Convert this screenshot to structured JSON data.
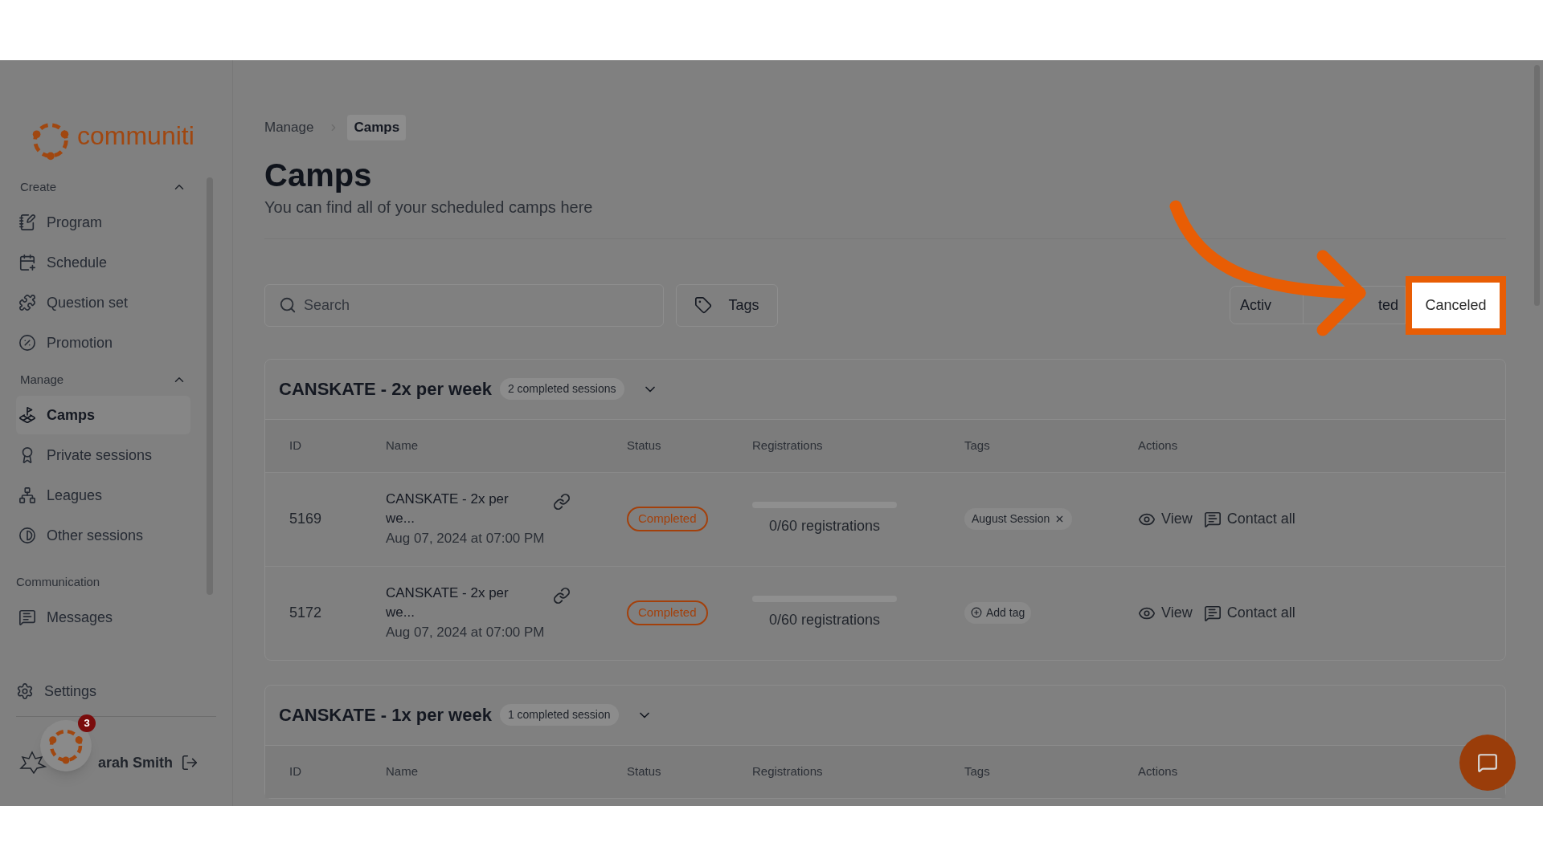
{
  "logo": {
    "text": "communiti"
  },
  "sidebar": {
    "sections": [
      {
        "label": "Create",
        "expanded": true,
        "items": [
          {
            "label": "Program",
            "selected": false
          },
          {
            "label": "Schedule",
            "selected": false
          },
          {
            "label": "Question set",
            "selected": false
          },
          {
            "label": "Promotion",
            "selected": false
          }
        ]
      },
      {
        "label": "Manage",
        "expanded": true,
        "items": [
          {
            "label": "Camps",
            "selected": true
          },
          {
            "label": "Private sessions",
            "selected": false
          },
          {
            "label": "Leagues",
            "selected": false
          },
          {
            "label": "Other sessions",
            "selected": false
          }
        ]
      },
      {
        "label": "Communication",
        "items": [
          {
            "label": "Messages",
            "selected": false
          }
        ]
      }
    ],
    "settings": {
      "label": "Settings"
    },
    "user": {
      "name": "arah Smith"
    },
    "notifications": {
      "count": "3"
    }
  },
  "breadcrumb": [
    {
      "label": "Manage",
      "selected": false
    },
    {
      "label": "Camps",
      "selected": true
    }
  ],
  "page": {
    "title": "Camps",
    "subtitle": "You can find all of your scheduled camps here"
  },
  "search": {
    "placeholder": "Search"
  },
  "tags_button": {
    "label": "Tags"
  },
  "status_filter": [
    {
      "label": "Activ",
      "selected": false
    },
    {
      "label": "ted",
      "selected": false
    },
    {
      "label": "Canceled",
      "selected": true
    }
  ],
  "groups": [
    {
      "title": "CANSKATE - 2x per week",
      "badge": "2 completed sessions",
      "expanded": true,
      "columns": [
        "ID",
        "Name",
        "Status",
        "Registrations",
        "Tags",
        "Actions"
      ],
      "rows": [
        {
          "id": "5169",
          "name": "CANSKATE - 2x per we...",
          "date": "Aug 07, 2024 at 07:00 PM",
          "status": "Completed",
          "level": 0,
          "registrations": "0/60 registrations",
          "tags": [
            {
              "kind": "tag",
              "label": "August Session"
            }
          ],
          "actions": [
            "View",
            "Contact all"
          ]
        },
        {
          "id": "5172",
          "name": "CANSKATE - 2x per we...",
          "date": "Aug 07, 2024 at 07:00 PM",
          "status": "Completed",
          "level": 0,
          "registrations": "0/60 registrations",
          "tags": [
            {
              "kind": "add",
              "label": "Add tag"
            }
          ],
          "actions": [
            "View",
            "Contact all"
          ]
        }
      ]
    },
    {
      "title": "CANSKATE - 1x per week",
      "badge": "1 completed session",
      "expanded": true,
      "columns": [
        "ID",
        "Name",
        "Status",
        "Registrations",
        "Tags",
        "Actions"
      ]
    }
  ]
}
